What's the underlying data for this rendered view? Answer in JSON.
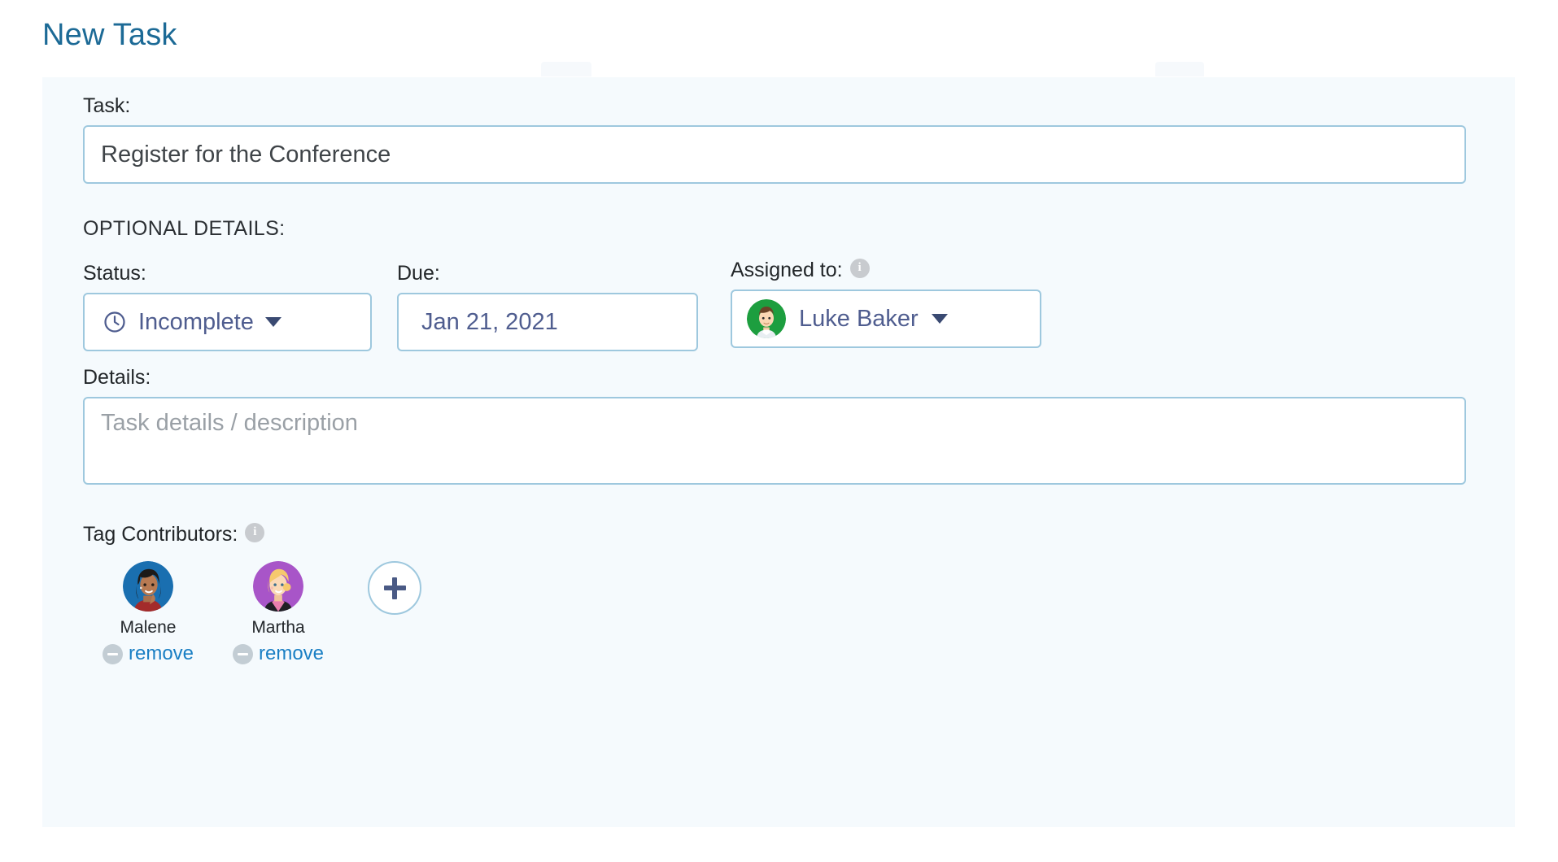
{
  "page": {
    "title": "New Task"
  },
  "form": {
    "task": {
      "label": "Task:",
      "value": "Register for the Conference"
    },
    "optional_details_label": "OPTIONAL DETAILS:",
    "status": {
      "label": "Status:",
      "value": "Incomplete",
      "icon": "clock-icon",
      "caret": "chevron-down-icon"
    },
    "due": {
      "label": "Due:",
      "value": "Jan 21, 2021"
    },
    "assigned": {
      "label": "Assigned to:",
      "info_icon": "info-icon",
      "value": "Luke Baker",
      "avatar_bg": "#1d9e3f",
      "caret": "chevron-down-icon"
    },
    "details": {
      "label": "Details:",
      "value": "",
      "placeholder": "Task details / description"
    },
    "tag_contributors": {
      "label": "Tag Contributors:",
      "info_icon": "info-icon",
      "add_label": "+",
      "people": [
        {
          "name": "Malene",
          "remove_label": "remove",
          "avatar_bg": "#1a6fb0"
        },
        {
          "name": "Martha",
          "remove_label": "remove",
          "avatar_bg": "#a855c8"
        }
      ]
    }
  },
  "colors": {
    "title": "#1c6a96",
    "panel_bg": "#f5fafd",
    "border": "#9ec8de",
    "select_text": "#4f5d8f",
    "link": "#1a7fc4",
    "placeholder": "#9aa0a6"
  }
}
